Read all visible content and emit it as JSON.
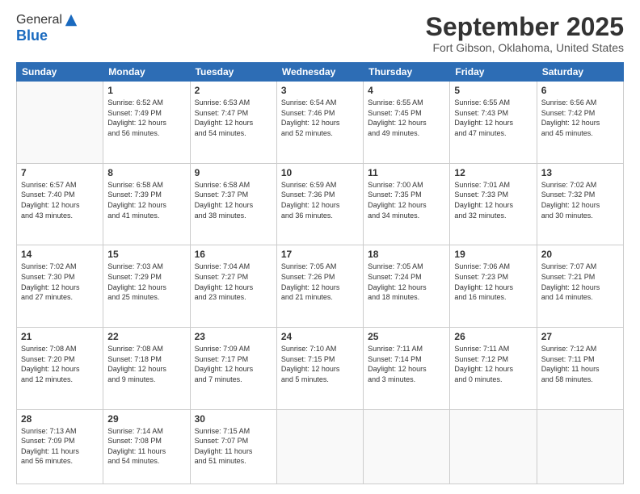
{
  "header": {
    "logo_general": "General",
    "logo_blue": "Blue",
    "month_title": "September 2025",
    "location": "Fort Gibson, Oklahoma, United States"
  },
  "days_of_week": [
    "Sunday",
    "Monday",
    "Tuesday",
    "Wednesday",
    "Thursday",
    "Friday",
    "Saturday"
  ],
  "weeks": [
    [
      {
        "day": "",
        "content": ""
      },
      {
        "day": "1",
        "content": "Sunrise: 6:52 AM\nSunset: 7:49 PM\nDaylight: 12 hours\nand 56 minutes."
      },
      {
        "day": "2",
        "content": "Sunrise: 6:53 AM\nSunset: 7:47 PM\nDaylight: 12 hours\nand 54 minutes."
      },
      {
        "day": "3",
        "content": "Sunrise: 6:54 AM\nSunset: 7:46 PM\nDaylight: 12 hours\nand 52 minutes."
      },
      {
        "day": "4",
        "content": "Sunrise: 6:55 AM\nSunset: 7:45 PM\nDaylight: 12 hours\nand 49 minutes."
      },
      {
        "day": "5",
        "content": "Sunrise: 6:55 AM\nSunset: 7:43 PM\nDaylight: 12 hours\nand 47 minutes."
      },
      {
        "day": "6",
        "content": "Sunrise: 6:56 AM\nSunset: 7:42 PM\nDaylight: 12 hours\nand 45 minutes."
      }
    ],
    [
      {
        "day": "7",
        "content": "Sunrise: 6:57 AM\nSunset: 7:40 PM\nDaylight: 12 hours\nand 43 minutes."
      },
      {
        "day": "8",
        "content": "Sunrise: 6:58 AM\nSunset: 7:39 PM\nDaylight: 12 hours\nand 41 minutes."
      },
      {
        "day": "9",
        "content": "Sunrise: 6:58 AM\nSunset: 7:37 PM\nDaylight: 12 hours\nand 38 minutes."
      },
      {
        "day": "10",
        "content": "Sunrise: 6:59 AM\nSunset: 7:36 PM\nDaylight: 12 hours\nand 36 minutes."
      },
      {
        "day": "11",
        "content": "Sunrise: 7:00 AM\nSunset: 7:35 PM\nDaylight: 12 hours\nand 34 minutes."
      },
      {
        "day": "12",
        "content": "Sunrise: 7:01 AM\nSunset: 7:33 PM\nDaylight: 12 hours\nand 32 minutes."
      },
      {
        "day": "13",
        "content": "Sunrise: 7:02 AM\nSunset: 7:32 PM\nDaylight: 12 hours\nand 30 minutes."
      }
    ],
    [
      {
        "day": "14",
        "content": "Sunrise: 7:02 AM\nSunset: 7:30 PM\nDaylight: 12 hours\nand 27 minutes."
      },
      {
        "day": "15",
        "content": "Sunrise: 7:03 AM\nSunset: 7:29 PM\nDaylight: 12 hours\nand 25 minutes."
      },
      {
        "day": "16",
        "content": "Sunrise: 7:04 AM\nSunset: 7:27 PM\nDaylight: 12 hours\nand 23 minutes."
      },
      {
        "day": "17",
        "content": "Sunrise: 7:05 AM\nSunset: 7:26 PM\nDaylight: 12 hours\nand 21 minutes."
      },
      {
        "day": "18",
        "content": "Sunrise: 7:05 AM\nSunset: 7:24 PM\nDaylight: 12 hours\nand 18 minutes."
      },
      {
        "day": "19",
        "content": "Sunrise: 7:06 AM\nSunset: 7:23 PM\nDaylight: 12 hours\nand 16 minutes."
      },
      {
        "day": "20",
        "content": "Sunrise: 7:07 AM\nSunset: 7:21 PM\nDaylight: 12 hours\nand 14 minutes."
      }
    ],
    [
      {
        "day": "21",
        "content": "Sunrise: 7:08 AM\nSunset: 7:20 PM\nDaylight: 12 hours\nand 12 minutes."
      },
      {
        "day": "22",
        "content": "Sunrise: 7:08 AM\nSunset: 7:18 PM\nDaylight: 12 hours\nand 9 minutes."
      },
      {
        "day": "23",
        "content": "Sunrise: 7:09 AM\nSunset: 7:17 PM\nDaylight: 12 hours\nand 7 minutes."
      },
      {
        "day": "24",
        "content": "Sunrise: 7:10 AM\nSunset: 7:15 PM\nDaylight: 12 hours\nand 5 minutes."
      },
      {
        "day": "25",
        "content": "Sunrise: 7:11 AM\nSunset: 7:14 PM\nDaylight: 12 hours\nand 3 minutes."
      },
      {
        "day": "26",
        "content": "Sunrise: 7:11 AM\nSunset: 7:12 PM\nDaylight: 12 hours\nand 0 minutes."
      },
      {
        "day": "27",
        "content": "Sunrise: 7:12 AM\nSunset: 7:11 PM\nDaylight: 11 hours\nand 58 minutes."
      }
    ],
    [
      {
        "day": "28",
        "content": "Sunrise: 7:13 AM\nSunset: 7:09 PM\nDaylight: 11 hours\nand 56 minutes."
      },
      {
        "day": "29",
        "content": "Sunrise: 7:14 AM\nSunset: 7:08 PM\nDaylight: 11 hours\nand 54 minutes."
      },
      {
        "day": "30",
        "content": "Sunrise: 7:15 AM\nSunset: 7:07 PM\nDaylight: 11 hours\nand 51 minutes."
      },
      {
        "day": "",
        "content": ""
      },
      {
        "day": "",
        "content": ""
      },
      {
        "day": "",
        "content": ""
      },
      {
        "day": "",
        "content": ""
      }
    ]
  ]
}
